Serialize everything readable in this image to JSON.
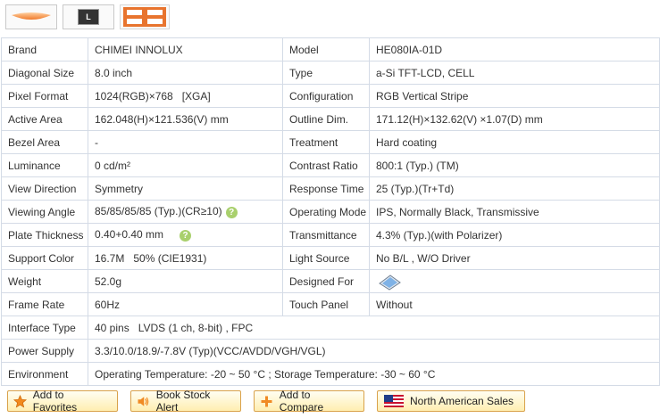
{
  "thumbnails": [
    {
      "icon": "lcd-panel-thumbnail"
    },
    {
      "icon": "connector-thumbnail",
      "text": "L"
    },
    {
      "icon": "dimension-drawing-thumbnail"
    }
  ],
  "specs": [
    {
      "l1": "Brand",
      "v1": "CHIMEI INNOLUX",
      "l2": "Model",
      "v2": "HE080IA-01D"
    },
    {
      "l1": "Diagonal Size",
      "v1": "8.0 inch",
      "l2": "Type",
      "v2": "a-Si TFT-LCD, CELL"
    },
    {
      "l1": "Pixel Format",
      "v1": "1024(RGB)×768   [XGA]",
      "l2": "Configuration",
      "v2": "RGB Vertical Stripe"
    },
    {
      "l1": "Active Area",
      "v1": "162.048(H)×121.536(V) mm",
      "l2": "Outline Dim.",
      "v2": "171.12(H)×132.62(V) ×1.07(D) mm"
    },
    {
      "l1": "Bezel Area",
      "v1": "-",
      "l2": "Treatment",
      "v2": "Hard coating"
    },
    {
      "l1": "Luminance",
      "v1": "0 cd/m²",
      "l2": "Contrast Ratio",
      "v2": "800:1 (Typ.) (TM)"
    },
    {
      "l1": "View Direction",
      "v1": "Symmetry",
      "l2": "Response Time",
      "v2": "25 (Typ.)(Tr+Td)"
    },
    {
      "l1": "Viewing Angle",
      "v1": "85/85/85/85 (Typ.)(CR≥10)",
      "l2": "Operating Mode",
      "v2": "IPS, Normally Black, Transmissive"
    },
    {
      "l1": "Plate Thickness",
      "v1": "0.40+0.40 mm",
      "l2": "Transmittance",
      "v2": "4.3% (Typ.)(with Polarizer)"
    },
    {
      "l1": "Support Color",
      "v1": "16.7M   50% (CIE1931)",
      "l2": "Light Source",
      "v2": "No B/L , W/O Driver"
    },
    {
      "l1": "Weight",
      "v1": "52.0g",
      "l2": "Designed For",
      "v2": ""
    },
    {
      "l1": "Frame Rate",
      "v1": "60Hz",
      "l2": "Touch Panel",
      "v2": "Without"
    },
    {
      "l1": "Interface Type",
      "v1": "40 pins   LVDS (1 ch, 8-bit) , FPC"
    },
    {
      "l1": "Power Supply",
      "v1": "3.3/10.0/18.9/-7.8V (Typ)(VCC/AVDD/VGH/VGL)"
    },
    {
      "l1": "Environment",
      "v1": "Operating Temperature: -20 ~ 50 °C ; Storage Temperature: -30 ~ 60 °C"
    }
  ],
  "actions": {
    "favorites": "Add to Favorites",
    "stock_alert": "Book Stock Alert",
    "compare": "Add to Compare",
    "sales": "North American Sales"
  },
  "colors": {
    "border": "#d4dbe6",
    "button_border": "#d9a24b",
    "help_icon": "#a9d06d"
  }
}
